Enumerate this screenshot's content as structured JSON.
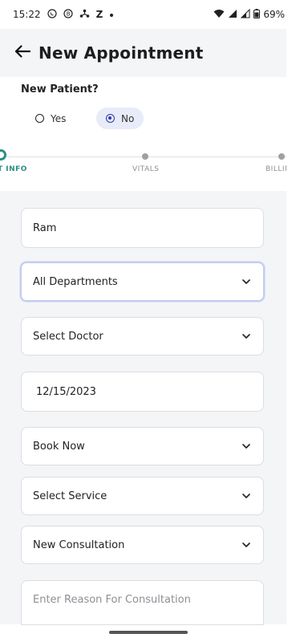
{
  "status_bar": {
    "time": "15:22",
    "icons": [
      "whatsapp-icon",
      "b-icon",
      "fan-icon",
      "z-icon",
      "dot-icon",
      "wifi-icon",
      "signal-icon",
      "signal-icon-2",
      "battery-icon"
    ],
    "z_label": "Z",
    "battery": "69%"
  },
  "header": {
    "title": "New Appointment",
    "back_icon": "arrow-left-icon"
  },
  "patient": {
    "question": "New Patient?",
    "options": [
      {
        "label": "Yes",
        "selected": false
      },
      {
        "label": "No",
        "selected": true
      }
    ]
  },
  "stepper": {
    "steps": [
      {
        "label": "T INFO",
        "active": true
      },
      {
        "label": "VITALS",
        "active": false
      },
      {
        "label": "BILLING",
        "active": false
      }
    ]
  },
  "form": {
    "name_value": "Ram",
    "department_value": "All Departments",
    "doctor_value": "Select Doctor",
    "date_value": "12/15/2023",
    "booking_value": "Book Now",
    "service_value": "Select Service",
    "consultation_value": "New Consultation",
    "reason_placeholder": "Enter Reason For Consultation"
  },
  "colors": {
    "accent_teal": "#2a8f87",
    "selected_radio_bg": "#e8ebf8",
    "radio_blue": "#2f3aa7",
    "focus_border": "#c4ccee",
    "background_grey": "#f4f5f7"
  }
}
